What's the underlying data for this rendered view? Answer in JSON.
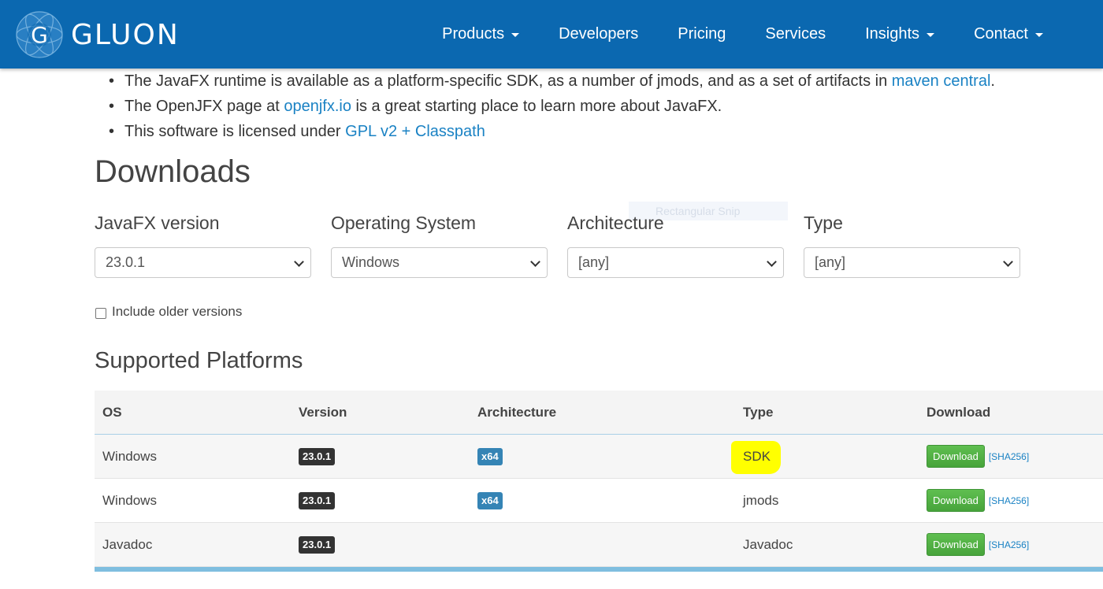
{
  "brand": {
    "name": "GLUON",
    "logo_letter": "G"
  },
  "nav": {
    "items": [
      {
        "label": "Products",
        "dropdown": true
      },
      {
        "label": "Developers",
        "dropdown": false
      },
      {
        "label": "Pricing",
        "dropdown": false
      },
      {
        "label": "Services",
        "dropdown": false
      },
      {
        "label": "Insights",
        "dropdown": true
      },
      {
        "label": "Contact",
        "dropdown": true
      }
    ]
  },
  "intro": {
    "b1_pre": "The JavaFX runtime is available as a platform-specific SDK, as a number of jmods, and as a set of artifacts in ",
    "b1_link": "maven central",
    "b1_post": ".",
    "b2_pre": "The OpenJFX page at ",
    "b2_link": "openjfx.io",
    "b2_post": " is a great starting place to learn more about JavaFX.",
    "b3_pre": "This software is licensed under ",
    "b3_link": "GPL v2 + Classpath"
  },
  "downloads": {
    "title": "Downloads",
    "filters": [
      {
        "label": "JavaFX version",
        "value": "23.0.1"
      },
      {
        "label": "Operating System",
        "value": "Windows"
      },
      {
        "label": "Architecture",
        "value": "[any]"
      },
      {
        "label": "Type",
        "value": "[any]"
      }
    ],
    "ghost_overlay": "Rectangular Snip",
    "include_older_label": "Include older versions",
    "include_older_checked": false
  },
  "platforms": {
    "title": "Supported Platforms",
    "columns": [
      "OS",
      "Version",
      "Architecture",
      "Type",
      "Download"
    ],
    "rows": [
      {
        "os": "Windows",
        "version": "23.0.1",
        "arch": "x64",
        "type": "SDK",
        "highlighted": true
      },
      {
        "os": "Windows",
        "version": "23.0.1",
        "arch": "x64",
        "type": "jmods",
        "highlighted": false
      },
      {
        "os": "Javadoc",
        "version": "23.0.1",
        "arch": "",
        "type": "Javadoc",
        "highlighted": false
      }
    ],
    "download_label": "Download",
    "sha_label": "[SHA256]"
  },
  "colors": {
    "navbar": "#0b68b0",
    "link": "#1a82c4",
    "download_button": "#55b34a",
    "arch_badge": "#3584b5",
    "version_badge": "#333333",
    "highlight": "#ffff00"
  }
}
